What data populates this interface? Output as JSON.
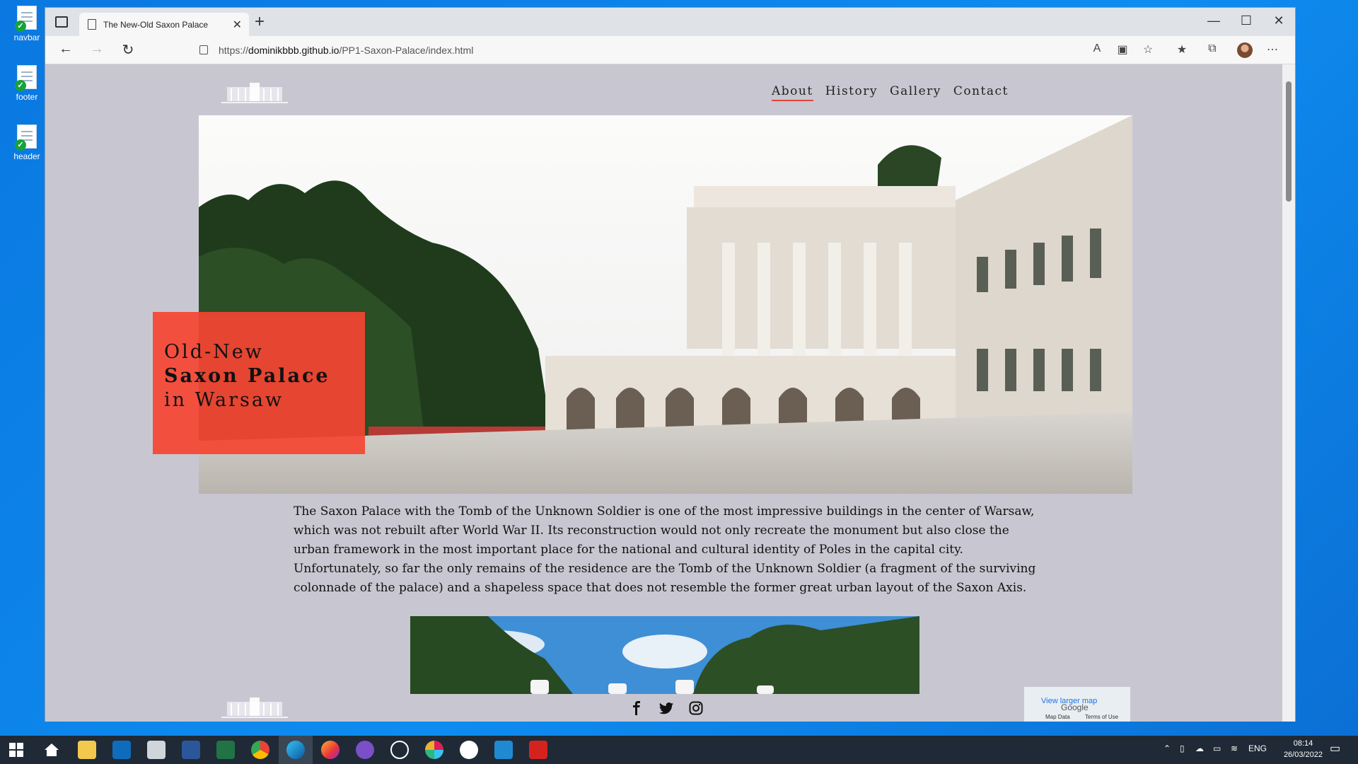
{
  "desktop": {
    "icons": [
      {
        "label": "navbar"
      },
      {
        "label": "footer"
      },
      {
        "label": "header"
      }
    ]
  },
  "browser": {
    "tab_title": "The New-Old Saxon Palace",
    "url_domain": "dominikbbb.github.io",
    "url_prefix": "https://",
    "url_path": "/PP1-Saxon-Palace/index.html"
  },
  "site": {
    "nav": [
      "About",
      "History",
      "Gallery",
      "Contact"
    ],
    "hero_title": {
      "line1": "Old-New",
      "line2": "Saxon Palace",
      "line3": "in Warsaw"
    },
    "intro": "The Saxon Palace with the Tomb of the Unknown Soldier is one of the most impressive buildings in the center of Warsaw, which was not rebuilt after World War II. Its reconstruction would not only recreate the monument but also close the urban framework in the most important place for the national and cultural identity of Poles in the capital city. Unfortunately, so far the only remains of the residence are the Tomb of the Unknown Soldier (a fragment of the surviving colonnade of the palace) and a shapeless space that does not resemble the former great urban layout of the Saxon Axis.",
    "map": {
      "link": "View larger map",
      "brand": "Google",
      "data": "Map Data",
      "terms": "Terms of Use"
    }
  },
  "taskbar": {
    "lang": "ENG",
    "time": "08:14",
    "date": "26/03/2022"
  },
  "colors": {
    "accent": "#e8443a",
    "page_bg": "#c8c7d1",
    "hero_box": "#f54432"
  }
}
